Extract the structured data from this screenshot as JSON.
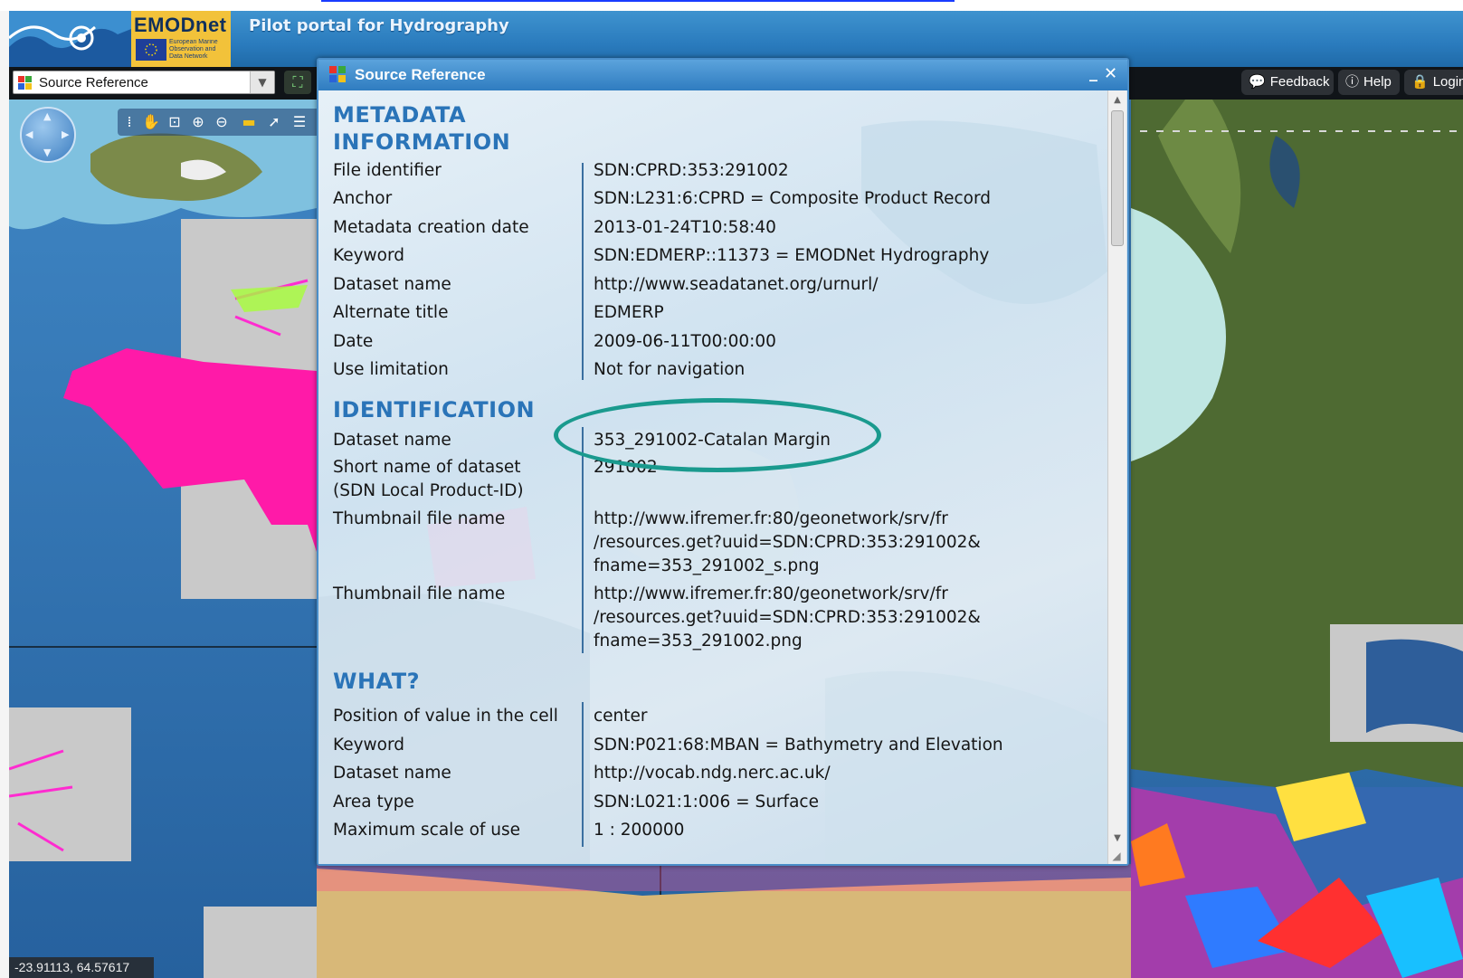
{
  "header": {
    "logo_text": "EMODnet",
    "logo_subtext": "European Marine Observation and Data Network",
    "portal_title": "Pilot portal for Hydrography"
  },
  "toolbar": {
    "layer_select_value": "Source Reference",
    "feedback_label": "Feedback",
    "help_label": "Help",
    "login_label": "Login"
  },
  "map": {
    "coordinates": "-23.91113, 64.57617"
  },
  "dialog": {
    "title": "Source Reference",
    "sections": {
      "metadata": {
        "heading_line1": "METADATA",
        "heading_line2": "INFORMATION",
        "rows": [
          {
            "label": "File identifier",
            "value": "SDN:CPRD:353:291002"
          },
          {
            "label": "Anchor",
            "value": "SDN:L231:6:CPRD = Composite Product Record"
          },
          {
            "label": "Metadata creation date",
            "value": "2013-01-24T10:58:40"
          },
          {
            "label": "Keyword",
            "value": "SDN:EDMERP::11373 = EMODNet Hydrography"
          },
          {
            "label": "Dataset name",
            "value": "http://www.seadatanet.org/urnurl/"
          },
          {
            "label": "Alternate title",
            "value": "EDMERP"
          },
          {
            "label": "Date",
            "value": "2009-06-11T00:00:00"
          },
          {
            "label": "Use limitation",
            "value": "Not for navigation"
          }
        ]
      },
      "identification": {
        "heading": "IDENTIFICATION",
        "dataset_name_label": "Dataset name",
        "dataset_name_value": "353_291002-Catalan Margin",
        "short_name_label_line1": "Short name of dataset",
        "short_name_label_line2": "(SDN Local Product-ID)",
        "short_name_value": "291002",
        "thumb1_label": "Thumbnail file name",
        "thumb1_value_line1": "http://www.ifremer.fr:80/geonetwork/srv/fr",
        "thumb1_value_line2": "/resources.get?uuid=SDN:CPRD:353:291002&",
        "thumb1_value_line3": "fname=353_291002_s.png",
        "thumb2_label": "Thumbnail file name",
        "thumb2_value_line1": "http://www.ifremer.fr:80/geonetwork/srv/fr",
        "thumb2_value_line2": "/resources.get?uuid=SDN:CPRD:353:291002&",
        "thumb2_value_line3": "fname=353_291002.png"
      },
      "what": {
        "heading": "WHAT?",
        "rows": [
          {
            "label": "Position of value in the cell",
            "value": "center"
          },
          {
            "label": "Keyword",
            "value": "SDN:P021:68:MBAN = Bathymetry and Elevation"
          },
          {
            "label": "Dataset name",
            "value": "http://vocab.ndg.nerc.ac.uk/"
          },
          {
            "label": "Area type",
            "value": "SDN:L021:1:006 = Surface"
          },
          {
            "label": "Maximum scale of use",
            "value": "1 : 200000"
          }
        ]
      }
    }
  },
  "colors": {
    "header_blue": "#2a7bbd",
    "section_heading": "#2a74b8",
    "highlight_ring": "#1a9a8e",
    "survey_magenta": "#ff1aa8"
  }
}
